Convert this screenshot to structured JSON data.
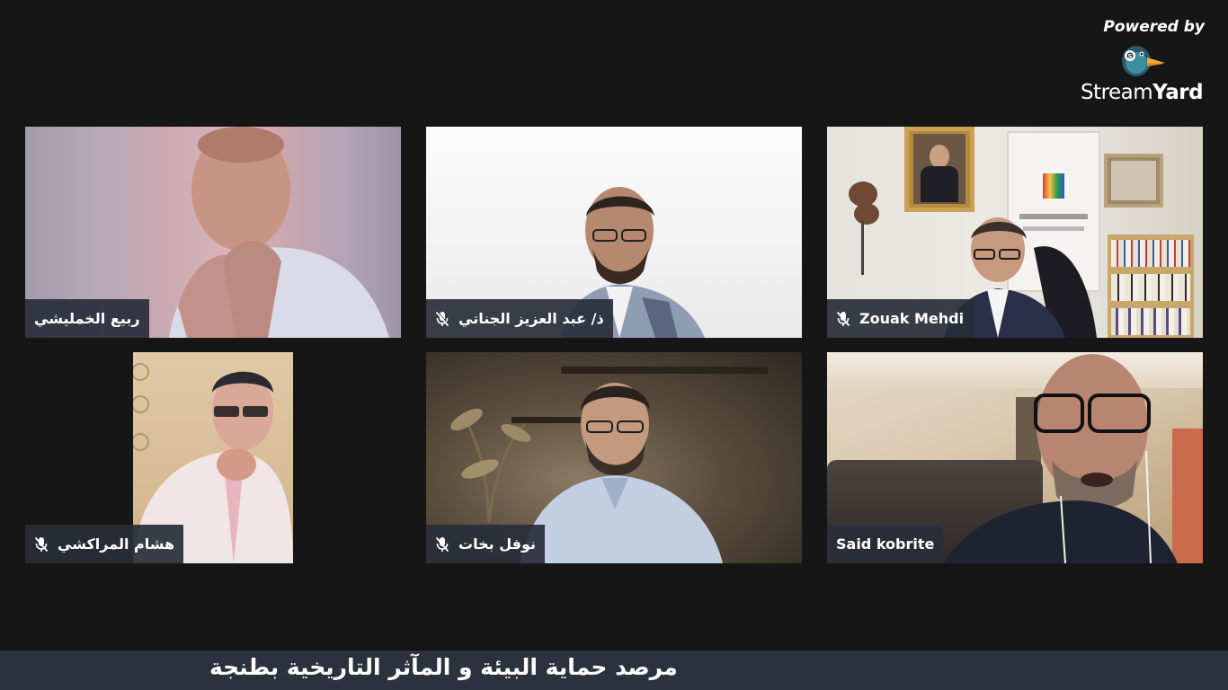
{
  "branding": {
    "powered_by": "Powered by",
    "name_light": "Stream",
    "name_bold": "Yard"
  },
  "participants": [
    {
      "name": "ربيع الخمليشي",
      "muted": false
    },
    {
      "name": "ذ/ عبد العزيز الجناتي",
      "muted": true
    },
    {
      "name": "Zouak Mehdi",
      "muted": true
    },
    {
      "name": "هشام المراكشي",
      "muted": true
    },
    {
      "name": "نوفل بخات",
      "muted": true
    },
    {
      "name": "Said kobrite",
      "muted": false
    }
  ],
  "ticker": {
    "text": "مرصد حماية البيئة و المآثر التاريخية بطنجة"
  },
  "colors": {
    "background": "#161616",
    "label_bg": "#282e3a",
    "ticker_bg": "#2b313d",
    "text": "#ffffff"
  }
}
